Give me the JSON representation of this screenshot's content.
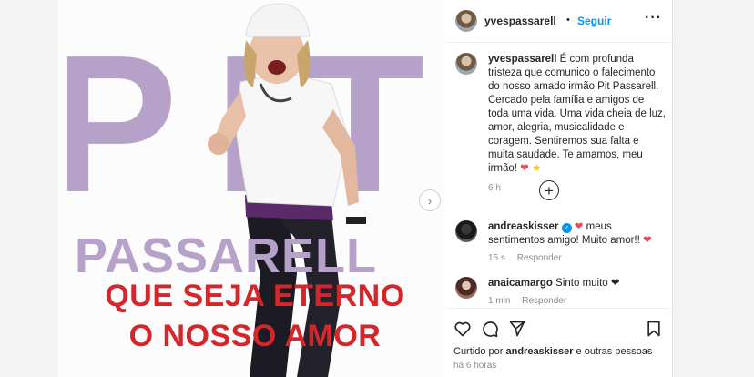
{
  "post": {
    "image": {
      "big_text": "PIT",
      "name_text": "PASSARELL",
      "slogan_line1": "QUE SEJA ETERNO",
      "slogan_line2": "O NOSSO AMOR",
      "colors": {
        "lilac": "#b6a1c9",
        "red": "#d4262b"
      }
    },
    "header": {
      "username": "yvespassarell",
      "separator": "•",
      "follow_label": "Seguir",
      "more_icon": "more-horizontal-icon"
    },
    "caption": {
      "username": "yvespassarell",
      "text": "É com profunda tristeza que comunico o falecimento do nosso amado irmão Pit Passarell. Cercado pela família e amigos de toda uma vida. Uma vida cheia de luz, amor, alegria, musicalidade e coragem. Sentiremos sua falta e muita saudade. Te amamos, meu irmão!",
      "emoji": "❤️ ⭐",
      "age": "6 h"
    },
    "comments": [
      {
        "username": "andreaskisser",
        "verified": true,
        "text": "❤️ meus sentimentos amigo! Muito amor!! ❤️",
        "age": "15 s",
        "reply_label": "Responder"
      },
      {
        "username": "anaicamargo",
        "verified": false,
        "text": "Sinto muito 🖤",
        "age": "1 min",
        "reply_label": "Responder"
      }
    ],
    "load_more_icon": "plus-circle-icon",
    "actions": [
      "heart-icon",
      "comment-icon",
      "share-icon",
      "bookmark-icon"
    ],
    "likes": {
      "prefix": "Curtido por",
      "user": "andreaskisser",
      "suffix": "e outras pessoas"
    },
    "timestamp": "há 6 horas"
  }
}
